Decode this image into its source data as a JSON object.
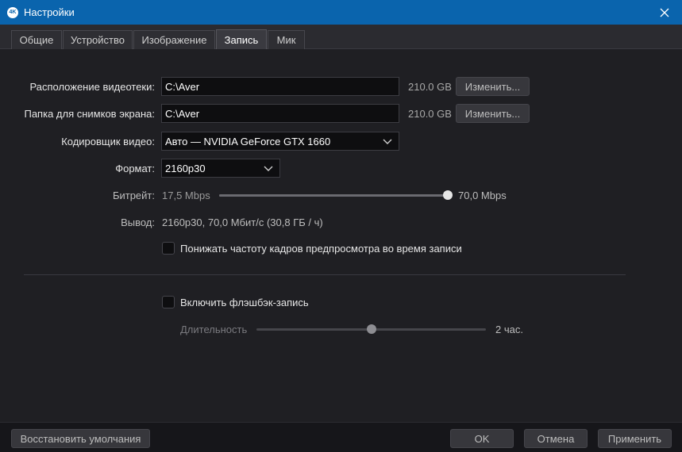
{
  "window": {
    "title": "Настройки",
    "app_icon_text": "4K"
  },
  "tabs": [
    {
      "label": "Общие"
    },
    {
      "label": "Устройство"
    },
    {
      "label": "Изображение"
    },
    {
      "label": "Запись",
      "active": true
    },
    {
      "label": "Мик"
    }
  ],
  "form": {
    "video_location": {
      "label": "Расположение видеотеки:",
      "value": "C:\\Aver",
      "size": "210.0 GB",
      "button": "Изменить..."
    },
    "screenshot_folder": {
      "label": "Папка для снимков экрана:",
      "value": "C:\\Aver",
      "size": "210.0 GB",
      "button": "Изменить..."
    },
    "encoder": {
      "label": "Кодировщик видео:",
      "selected": "Авто — NVIDIA GeForce GTX 1660"
    },
    "format": {
      "label": "Формат:",
      "selected": "2160p30"
    },
    "bitrate": {
      "label": "Битрейт:",
      "min": "17,5 Mbps",
      "max": "70,0 Mbps",
      "position_fraction": 1.0
    },
    "output": {
      "label": "Вывод:",
      "value": "2160p30, 70,0 Мбит/с (30,8 ГБ / ч)"
    },
    "reduce_preview_fps": {
      "label": "Понижать частоту кадров предпросмотра во время записи",
      "checked": false
    },
    "flashback": {
      "label": "Включить флэшбэк-запись",
      "checked": false
    },
    "duration": {
      "label": "Длительность",
      "value": "2 час.",
      "position_fraction": 0.5
    }
  },
  "footer": {
    "restore_defaults": "Восстановить умолчания",
    "ok": "OK",
    "cancel": "Отмена",
    "apply": "Применить"
  },
  "colors": {
    "titlebar": "#0a64ad",
    "background": "#1f1f23",
    "field": "#0e0e10",
    "button": "#37373c"
  }
}
